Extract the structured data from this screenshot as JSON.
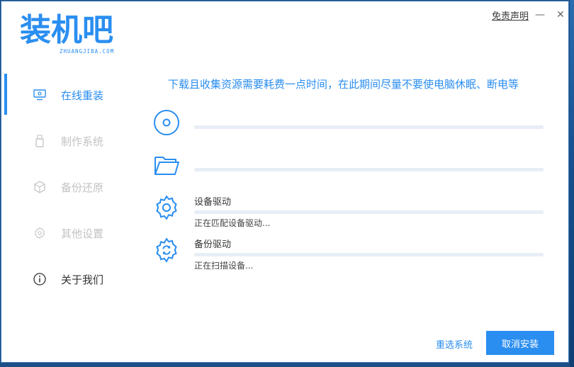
{
  "app": {
    "logo_text": "装机吧",
    "logo_sub": "ZHUANGJIBA.COM",
    "disclaimer": "免责声明",
    "minimize_glyph": "—",
    "close_glyph": "✕"
  },
  "sidebar": {
    "items": [
      {
        "label": "在线重装",
        "icon": "monitor-icon",
        "state": "active"
      },
      {
        "label": "制作系统",
        "icon": "usb-drive-icon",
        "state": "disabled"
      },
      {
        "label": "备份还原",
        "icon": "cube-icon",
        "state": "disabled"
      },
      {
        "label": "其他设置",
        "icon": "gear-icon",
        "state": "disabled"
      },
      {
        "label": "关于我们",
        "icon": "info-icon",
        "state": "normal"
      }
    ]
  },
  "main": {
    "notice": "下载且收集资源需要耗费一点时间，在此期间尽量不要使电脑休眠、断电等",
    "steps": [
      {
        "icon": "disc-icon",
        "name": "",
        "status": "",
        "progress": 0
      },
      {
        "icon": "folder-icon",
        "name": "",
        "status": "",
        "progress": 0
      },
      {
        "icon": "gear-icon",
        "name": "设备驱动",
        "status": "正在匹配设备驱动...",
        "progress": 0
      },
      {
        "icon": "sync-gear-icon",
        "name": "备份驱动",
        "status": "正在扫描设备...",
        "progress": 0
      }
    ]
  },
  "footer": {
    "reselect_label": "重选系统",
    "cancel_label": "取消安装"
  },
  "colors": {
    "accent": "#2a8ef0",
    "disabled_text": "#c2c2c2",
    "track": "#e8eef6"
  }
}
